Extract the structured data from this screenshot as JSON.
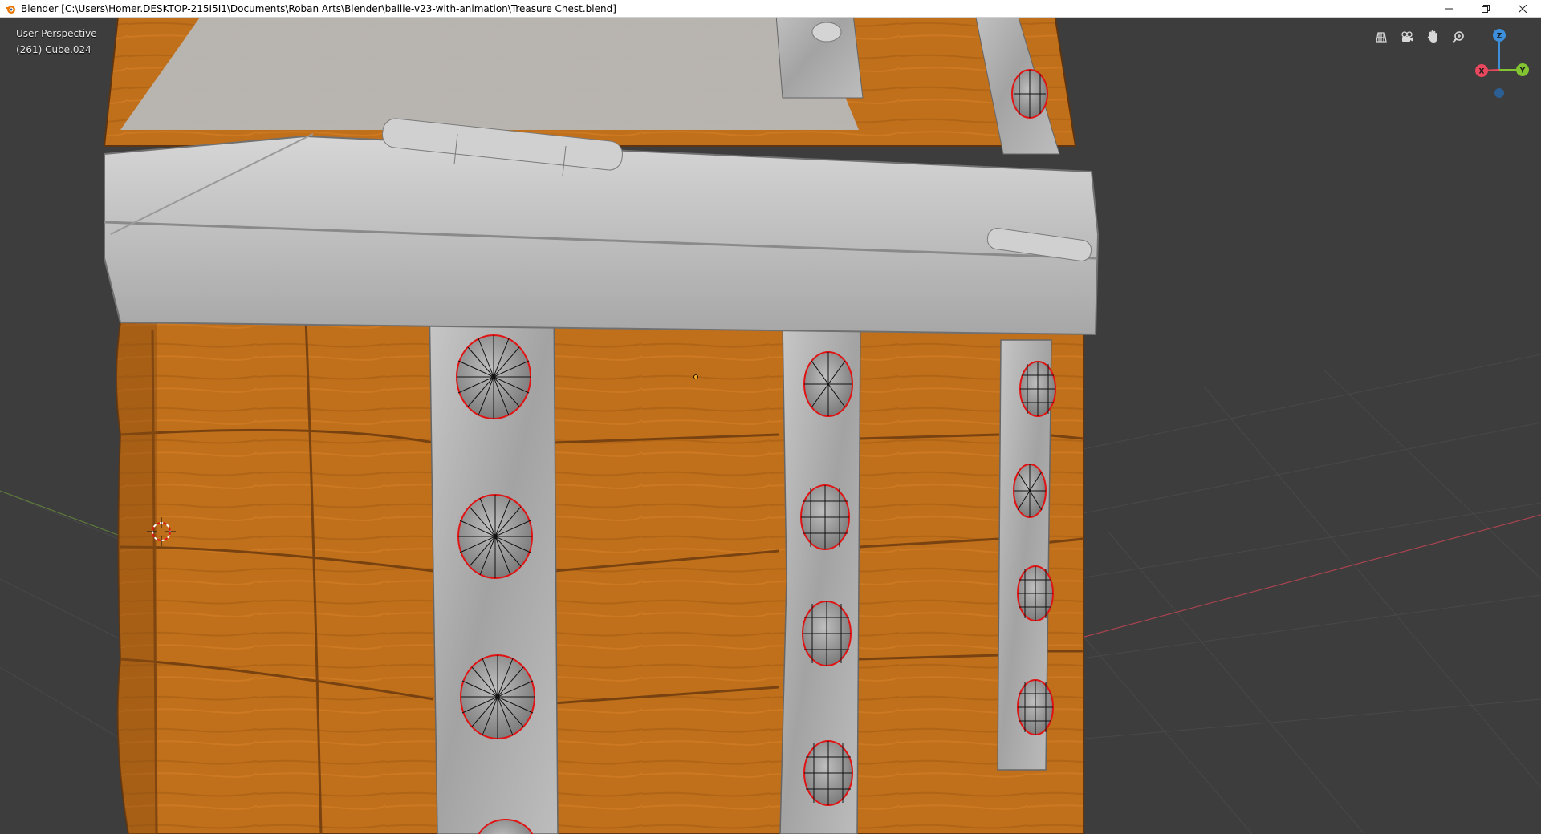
{
  "titlebar": {
    "title": "Blender [C:\\Users\\Homer.DESKTOP-215I5I1\\Documents\\Roban Arts\\Blender\\ballie-v23-with-animation\\Treasure Chest.blend]",
    "app_icon": "blender-icon",
    "controls": {
      "minimize_icon": "minimize-icon",
      "restore_icon": "restore-icon",
      "close_icon": "close-icon"
    }
  },
  "viewport": {
    "view_name": "User Perspective",
    "object_info": "(261) Cube.024",
    "nav_tools": [
      {
        "name": "toggle-quad-view-button",
        "icon": "grid-icon"
      },
      {
        "name": "camera-view-button",
        "icon": "camera-icon"
      },
      {
        "name": "pan-view-button",
        "icon": "hand-icon"
      },
      {
        "name": "zoom-view-button",
        "icon": "zoom-icon"
      }
    ],
    "gizmo": {
      "axes": [
        "X",
        "Y",
        "Z"
      ],
      "x_color": "#e8475d",
      "y_color": "#82c431",
      "z_color": "#3d8fdc"
    }
  },
  "colors": {
    "viewport_bg": "#3d3d3d",
    "wood": "#c06f1b",
    "wood_dark": "#8a4c12",
    "metal": "#b5b5b5",
    "metal_dark": "#8e8e8e",
    "selection_outline": "#e01414"
  }
}
